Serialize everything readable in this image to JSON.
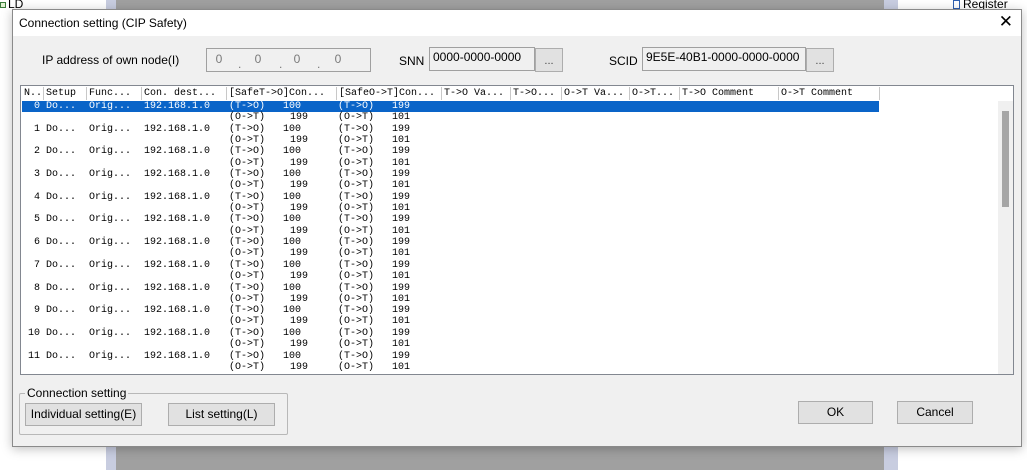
{
  "background": {
    "left_label": "LD",
    "right_label": "Register"
  },
  "dialog": {
    "title": "Connection setting (CIP Safety)",
    "close_glyph": "✕"
  },
  "ip": {
    "label": "IP address of own node(I)",
    "octets": [
      "0",
      "0",
      "0",
      "0"
    ]
  },
  "snn": {
    "label": "SNN",
    "value": "0000-0000-0000",
    "button": "..."
  },
  "scid": {
    "label": "SCID",
    "value": "9E5E-40B1-0000-0000-0000",
    "button": "..."
  },
  "table": {
    "columns": [
      "N..",
      "Setup",
      "Func...",
      "Con. dest...",
      "[SafeT->O]Con...",
      "[SafeO->T]Con...",
      "T->O Va...",
      "T->O...",
      "O->T Va...",
      "O->T...",
      "T->O Comment",
      "O->T Comment"
    ],
    "rows": [
      {
        "no": "0",
        "setup": "Do...",
        "func": "Orig...",
        "dest": "192.168.1.0",
        "a1": "(T->O)",
        "a1v": "100",
        "a2": "(O->T)",
        "a2v": "199",
        "b1": "(T->O)",
        "b1v": "199",
        "b2": "(O->T)",
        "b2v": "101"
      },
      {
        "no": "1",
        "setup": "Do...",
        "func": "Orig...",
        "dest": "192.168.1.0",
        "a1": "(T->O)",
        "a1v": "100",
        "a2": "(O->T)",
        "a2v": "199",
        "b1": "(T->O)",
        "b1v": "199",
        "b2": "(O->T)",
        "b2v": "101"
      },
      {
        "no": "2",
        "setup": "Do...",
        "func": "Orig...",
        "dest": "192.168.1.0",
        "a1": "(T->O)",
        "a1v": "100",
        "a2": "(O->T)",
        "a2v": "199",
        "b1": "(T->O)",
        "b1v": "199",
        "b2": "(O->T)",
        "b2v": "101"
      },
      {
        "no": "3",
        "setup": "Do...",
        "func": "Orig...",
        "dest": "192.168.1.0",
        "a1": "(T->O)",
        "a1v": "100",
        "a2": "(O->T)",
        "a2v": "199",
        "b1": "(T->O)",
        "b1v": "199",
        "b2": "(O->T)",
        "b2v": "101"
      },
      {
        "no": "4",
        "setup": "Do...",
        "func": "Orig...",
        "dest": "192.168.1.0",
        "a1": "(T->O)",
        "a1v": "100",
        "a2": "(O->T)",
        "a2v": "199",
        "b1": "(T->O)",
        "b1v": "199",
        "b2": "(O->T)",
        "b2v": "101"
      },
      {
        "no": "5",
        "setup": "Do...",
        "func": "Orig...",
        "dest": "192.168.1.0",
        "a1": "(T->O)",
        "a1v": "100",
        "a2": "(O->T)",
        "a2v": "199",
        "b1": "(T->O)",
        "b1v": "199",
        "b2": "(O->T)",
        "b2v": "101"
      },
      {
        "no": "6",
        "setup": "Do...",
        "func": "Orig...",
        "dest": "192.168.1.0",
        "a1": "(T->O)",
        "a1v": "100",
        "a2": "(O->T)",
        "a2v": "199",
        "b1": "(T->O)",
        "b1v": "199",
        "b2": "(O->T)",
        "b2v": "101"
      },
      {
        "no": "7",
        "setup": "Do...",
        "func": "Orig...",
        "dest": "192.168.1.0",
        "a1": "(T->O)",
        "a1v": "100",
        "a2": "(O->T)",
        "a2v": "199",
        "b1": "(T->O)",
        "b1v": "199",
        "b2": "(O->T)",
        "b2v": "101"
      },
      {
        "no": "8",
        "setup": "Do...",
        "func": "Orig...",
        "dest": "192.168.1.0",
        "a1": "(T->O)",
        "a1v": "100",
        "a2": "(O->T)",
        "a2v": "199",
        "b1": "(T->O)",
        "b1v": "199",
        "b2": "(O->T)",
        "b2v": "101"
      },
      {
        "no": "9",
        "setup": "Do...",
        "func": "Orig...",
        "dest": "192.168.1.0",
        "a1": "(T->O)",
        "a1v": "100",
        "a2": "(O->T)",
        "a2v": "199",
        "b1": "(T->O)",
        "b1v": "199",
        "b2": "(O->T)",
        "b2v": "101"
      },
      {
        "no": "10",
        "setup": "Do...",
        "func": "Orig...",
        "dest": "192.168.1.0",
        "a1": "(T->O)",
        "a1v": "100",
        "a2": "(O->T)",
        "a2v": "199",
        "b1": "(T->O)",
        "b1v": "199",
        "b2": "(O->T)",
        "b2v": "101"
      },
      {
        "no": "11",
        "setup": "Do...",
        "func": "Orig...",
        "dest": "192.168.1.0",
        "a1": "(T->O)",
        "a1v": "100",
        "a2": "(O->T)",
        "a2v": "199",
        "b1": "(T->O)",
        "b1v": "199",
        "b2": "(O->T)",
        "b2v": "101"
      }
    ],
    "selected_row": 0
  },
  "connection_setting": {
    "legend": "Connection setting",
    "individual_label": "Individual setting(E)",
    "list_label": "List setting(L)"
  },
  "footer": {
    "ok_label": "OK",
    "cancel_label": "Cancel"
  },
  "colors": {
    "selection": "#0a64c8",
    "dialog_bg": "#f0f0f0"
  }
}
